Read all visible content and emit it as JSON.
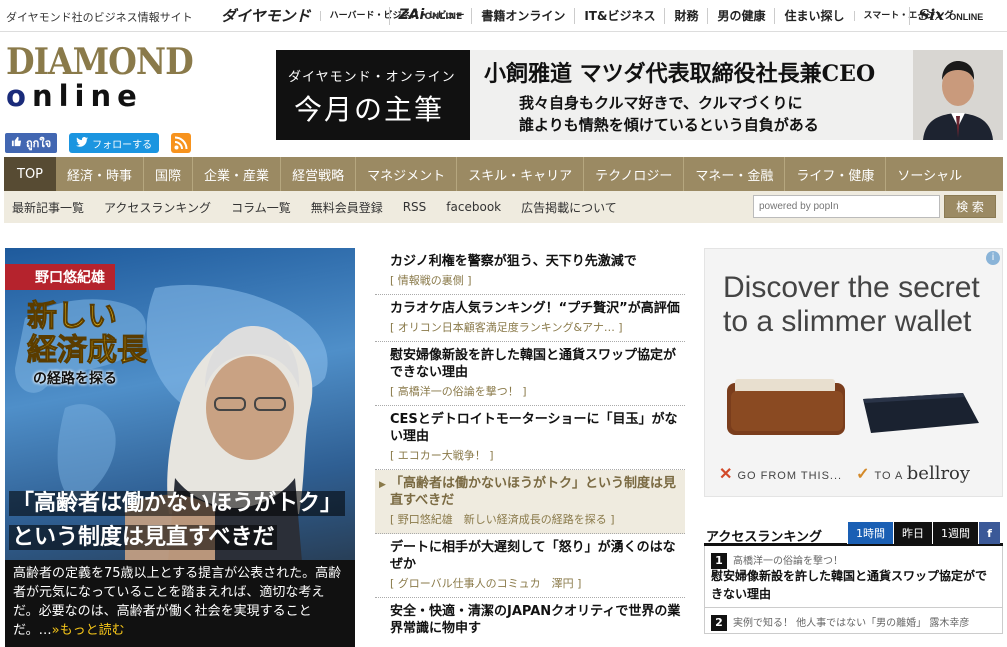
{
  "topbar": {
    "site_desc": "ダイヤモンド社のビジネス情報サイト",
    "links": [
      {
        "label": "ダイヤモンド",
        "name": "diamond"
      },
      {
        "label": "ハーバード・ビジネス・レビュー",
        "name": "hbr"
      },
      {
        "label": "ZAi",
        "sub": "ONLINE",
        "name": "zai"
      },
      {
        "label": "書籍オンライン",
        "name": "books"
      },
      {
        "label": "IT&ビジネス",
        "name": "it"
      },
      {
        "label": "財務",
        "name": "finance"
      },
      {
        "label": "男の健康",
        "name": "health"
      },
      {
        "label": "住まい探し",
        "name": "housing"
      },
      {
        "label": "スマート・エイジング",
        "name": "smart"
      },
      {
        "label": "Six",
        "sub": "ONLINE",
        "name": "six"
      }
    ]
  },
  "logo": {
    "line1": "DIAMOND",
    "line2_o": "o",
    "line2_rest": "nline"
  },
  "social": {
    "like": "ถูกใจ",
    "follow": "フォローする"
  },
  "banner": {
    "tag": "ダイヤモンド・オンライン",
    "heading": "今月の主筆",
    "name": "小飼雅道 マツダ代表取締役社長兼CEO",
    "quote1": "我々自身もクルマ好きで、クルマづくりに",
    "quote2": "誰よりも情熱を傾けているという自負がある"
  },
  "nav": [
    "TOP",
    "経済・時事",
    "国際",
    "企業・産業",
    "経営戦略",
    "マネジメント",
    "スキル・キャリア",
    "テクノロジー",
    "マネー・金融",
    "ライフ・健康",
    "ソーシャル"
  ],
  "subnav": [
    "最新記事一覧",
    "アクセスランキング",
    "コラム一覧",
    "無料会員登録",
    "RSS",
    "facebook",
    "広告掲載について"
  ],
  "search": {
    "placeholder": "powered by popIn",
    "button": "検 索"
  },
  "feature": {
    "author": "野口悠紀雄",
    "title1": "新しい",
    "title2": "経済成長",
    "title3": "の経路を探る",
    "headline1": "「高齢者は働かないほうがトク」",
    "headline2": "という制度は見直すべきだ",
    "lead": "高齢者の定義を75歳以上とする提言が公表された。高齢者が元気になっていることを踏まえれば、適切な考えだ。必要なのは、高齢者が働く社会を実現することだ。…",
    "more": "»もっと読む"
  },
  "news": [
    {
      "title": "カジノ利権を警察が狙う、天下り先激減で",
      "cat": "[ 情報戦の裏側 ]"
    },
    {
      "title": "カラオケ店人気ランキング！“プチ贅沢”が高評価",
      "cat": "[ オリコン日本顧客満足度ランキング&アナ… ]"
    },
    {
      "title": "慰安婦像新設を許した韓国と通貨スワップ協定ができない理由",
      "cat": "[ 高橋洋一の俗論を撃つ！ ]"
    },
    {
      "title": "CESとデトロイトモーターショーに「目玉」がない理由",
      "cat": "[ エコカー大戦争！ ]"
    },
    {
      "title": "「高齢者は働かないほうがトク」という制度は見直すべきだ",
      "cat": "[ 野口悠紀雄　新しい経済成長の経路を探る ]",
      "active": true
    },
    {
      "title": "デートに相手が大遅刻して「怒り」が湧くのはなぜか",
      "cat": "[ グローバル仕事人のコミュカ　澤円 ]"
    },
    {
      "title": "安全・快適・清潔のJAPANクオリティで世界の業界常識に物申す",
      "cat": ""
    }
  ],
  "ad": {
    "title1": "Discover the secret",
    "title2": "to a slimmer wallet",
    "foot1": "GO FROM THIS...",
    "foot2": "TO A",
    "brand": "bellroy"
  },
  "ranking": {
    "title": "アクセスランキング",
    "tabs": [
      "1時間",
      "昨日",
      "1週間",
      "f"
    ],
    "items": [
      {
        "num": "1",
        "cat": "高橋洋一の俗論を撃つ！",
        "title": "慰安婦像新設を許した韓国と通貨スワップ協定ができない理由"
      },
      {
        "num": "2",
        "cat": "実例で知る！ 他人事ではない「男の離婚」 露木幸彦",
        "title": ""
      }
    ]
  },
  "colors": {
    "nav_bg": "#9b8a63",
    "nav_active": "#574b33",
    "subnav_bg": "#efebdf",
    "accent_red": "#b5232d",
    "rank_tab_active": "#1a5fb4"
  }
}
